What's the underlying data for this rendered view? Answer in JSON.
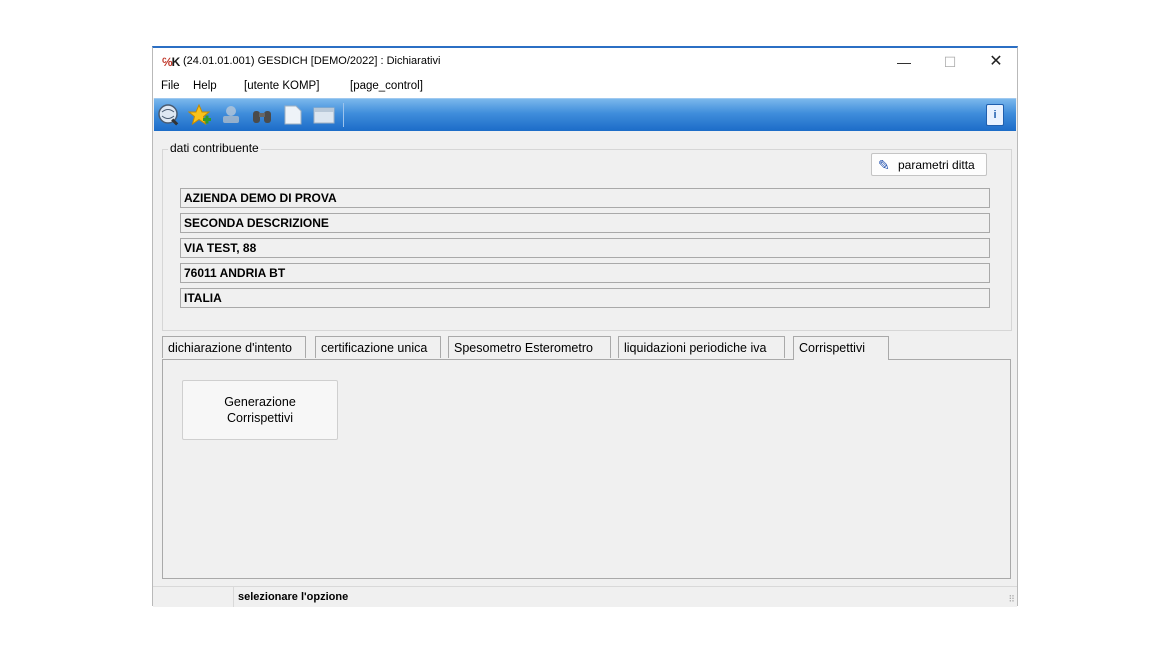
{
  "window": {
    "title": "(24.01.01.001) GESDICH [DEMO/2022] : Dichiarativi",
    "controls": {
      "minimize": "—",
      "maximize": "☐",
      "close": "✕"
    }
  },
  "menu": {
    "items": [
      "File",
      "Help",
      "[utente KOMP]",
      "[page_control]"
    ]
  },
  "toolbar": {
    "icons": [
      "globe-search-icon",
      "star-add-icon",
      "network-icon",
      "binoculars-icon",
      "document-edit-icon",
      "window-icon",
      "info-icon"
    ],
    "info_label": "i"
  },
  "contributor": {
    "legend": "dati contribuente",
    "params_button": "parametri ditta",
    "fields": [
      "AZIENDA DEMO DI PROVA",
      "SECONDA DESCRIZIONE",
      "VIA TEST, 88",
      "76011 ANDRIA BT",
      "ITALIA"
    ]
  },
  "tabs": {
    "items": [
      "dichiarazione d'intento",
      "certificazione unica",
      "Spesometro Esterometro",
      "liquidazioni periodiche iva",
      "Corrispettivi"
    ],
    "active": "Corrispettivi"
  },
  "panel": {
    "button_label": "Generazione\nCorrispettivi"
  },
  "status": {
    "text": "selezionare l'opzione"
  }
}
